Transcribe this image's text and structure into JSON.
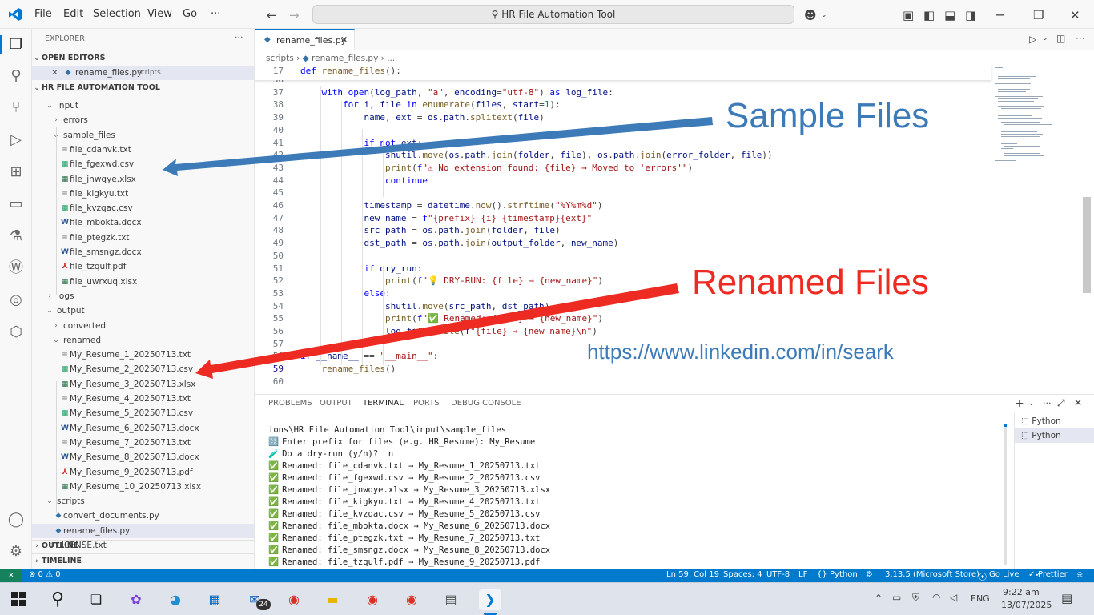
{
  "titlebar": {
    "menu": [
      "File",
      "Edit",
      "Selection",
      "View",
      "Go",
      "···"
    ],
    "search_text": "HR File Automation Tool"
  },
  "tab": {
    "label": "rename_files.py"
  },
  "breadcrumb": {
    "folder": "scripts",
    "file": "rename_files.py",
    "rest": "..."
  },
  "sticky": {
    "num": "17",
    "code": "def rename_files():"
  },
  "code_lines": [
    {
      "num": "36",
      "code": ""
    },
    {
      "num": "37",
      "code": "    with open(log_path, \"a\", encoding=\"utf-8\") as log_file:"
    },
    {
      "num": "38",
      "code": "        for i, file in enumerate(files, start=1):"
    },
    {
      "num": "39",
      "code": "            name, ext = os.path.splitext(file)"
    },
    {
      "num": "40",
      "code": ""
    },
    {
      "num": "41",
      "code": "            if not ext:"
    },
    {
      "num": "42",
      "code": "                shutil.move(os.path.join(folder, file), os.path.join(error_folder, file))"
    },
    {
      "num": "43",
      "code": "                print(f\"⚠ No extension found: {file} → Moved to 'errors'\")"
    },
    {
      "num": "44",
      "code": "                continue"
    },
    {
      "num": "45",
      "code": ""
    },
    {
      "num": "46",
      "code": "            timestamp = datetime.now().strftime(\"%Y%m%d\")"
    },
    {
      "num": "47",
      "code": "            new_name = f\"{prefix}_{i}_{timestamp}{ext}\""
    },
    {
      "num": "48",
      "code": "            src_path = os.path.join(folder, file)"
    },
    {
      "num": "49",
      "code": "            dst_path = os.path.join(output_folder, new_name)"
    },
    {
      "num": "50",
      "code": ""
    },
    {
      "num": "51",
      "code": "            if dry_run:"
    },
    {
      "num": "52",
      "code": "                print(f\"💡 DRY-RUN: {file} → {new_name}\")"
    },
    {
      "num": "53",
      "code": "            else:"
    },
    {
      "num": "54",
      "code": "                shutil.move(src_path, dst_path)"
    },
    {
      "num": "55",
      "code": "                print(f\"✅ Renamed: {file} → {new_name}\")"
    },
    {
      "num": "56",
      "code": "                log_file.write(f\"{file} → {new_name}\\n\")"
    },
    {
      "num": "57",
      "code": ""
    },
    {
      "num": "58",
      "code": "if __name__ == \"__main__\":"
    },
    {
      "num": "59",
      "code": "    rename_files()"
    },
    {
      "num": "60",
      "code": ""
    }
  ],
  "annotations": {
    "sample_files": "Sample Files",
    "renamed_files": "Renamed Files",
    "linkedin": "https://www.linkedin.com/in/seark"
  },
  "explorer": {
    "title": "EXPLORER",
    "open_editors_label": "OPEN EDITORS",
    "open_editor_file": "rename_files.py",
    "open_editor_folder": "scripts",
    "project_label": "HR FILE AUTOMATION TOOL",
    "outline_label": "OUTLINE",
    "timeline_label": "TIMELINE",
    "tree": [
      {
        "label": "input",
        "indent": 1,
        "chev": "⌄",
        "kind": "folder"
      },
      {
        "label": "errors",
        "indent": 2,
        "chev": "›",
        "kind": "folder"
      },
      {
        "label": "sample_files",
        "indent": 2,
        "chev": "⌄",
        "kind": "folder"
      },
      {
        "label": "file_cdanvk.txt",
        "indent": 3,
        "kind": "txt"
      },
      {
        "label": "file_fgexwd.csv",
        "indent": 3,
        "kind": "csv"
      },
      {
        "label": "file_jnwqye.xlsx",
        "indent": 3,
        "kind": "xlsx"
      },
      {
        "label": "file_kigkyu.txt",
        "indent": 3,
        "kind": "txt"
      },
      {
        "label": "file_kvzqac.csv",
        "indent": 3,
        "kind": "csv"
      },
      {
        "label": "file_mbokta.docx",
        "indent": 3,
        "kind": "docx"
      },
      {
        "label": "file_ptegzk.txt",
        "indent": 3,
        "kind": "txt"
      },
      {
        "label": "file_smsngz.docx",
        "indent": 3,
        "kind": "docx"
      },
      {
        "label": "file_tzqulf.pdf",
        "indent": 3,
        "kind": "pdf"
      },
      {
        "label": "file_uwrxuq.xlsx",
        "indent": 3,
        "kind": "xlsx"
      },
      {
        "label": "logs",
        "indent": 1,
        "chev": "›",
        "kind": "folder"
      },
      {
        "label": "output",
        "indent": 1,
        "chev": "⌄",
        "kind": "folder"
      },
      {
        "label": "converted",
        "indent": 2,
        "chev": "›",
        "kind": "folder"
      },
      {
        "label": "renamed",
        "indent": 2,
        "chev": "⌄",
        "kind": "folder"
      },
      {
        "label": "My_Resume_1_20250713.txt",
        "indent": 3,
        "kind": "txt"
      },
      {
        "label": "My_Resume_2_20250713.csv",
        "indent": 3,
        "kind": "csv"
      },
      {
        "label": "My_Resume_3_20250713.xlsx",
        "indent": 3,
        "kind": "xlsx"
      },
      {
        "label": "My_Resume_4_20250713.txt",
        "indent": 3,
        "kind": "txt"
      },
      {
        "label": "My_Resume_5_20250713.csv",
        "indent": 3,
        "kind": "csv"
      },
      {
        "label": "My_Resume_6_20250713.docx",
        "indent": 3,
        "kind": "docx"
      },
      {
        "label": "My_Resume_7_20250713.txt",
        "indent": 3,
        "kind": "txt"
      },
      {
        "label": "My_Resume_8_20250713.docx",
        "indent": 3,
        "kind": "docx"
      },
      {
        "label": "My_Resume_9_20250713.pdf",
        "indent": 3,
        "kind": "pdf"
      },
      {
        "label": "My_Resume_10_20250713.xlsx",
        "indent": 3,
        "kind": "xlsx"
      },
      {
        "label": "scripts",
        "indent": 1,
        "chev": "⌄",
        "kind": "folder"
      },
      {
        "label": "convert_documents.py",
        "indent": 2,
        "kind": "py"
      },
      {
        "label": "rename_files.py",
        "indent": 2,
        "kind": "py",
        "selected": true
      },
      {
        "label": "LICENSE.txt",
        "indent": 1,
        "kind": "txt"
      }
    ]
  },
  "panel": {
    "tabs": [
      "PROBLEMS",
      "OUTPUT",
      "TERMINAL",
      "PORTS",
      "DEBUG CONSOLE"
    ],
    "active_tab": "TERMINAL",
    "terminals": [
      "Python",
      "Python"
    ],
    "lines": [
      {
        "icon": "",
        "text": "ions\\HR File Automation Tool\\input\\sample_files"
      },
      {
        "icon": "🔠",
        "text": "Enter prefix for files (e.g. HR_Resume): My_Resume"
      },
      {
        "icon": "🧪",
        "text": "Do a dry-run (y/n)?  n"
      },
      {
        "icon": "✅",
        "text": "Renamed: file_cdanvk.txt → My_Resume_1_20250713.txt"
      },
      {
        "icon": "✅",
        "text": "Renamed: file_fgexwd.csv → My_Resume_2_20250713.csv"
      },
      {
        "icon": "✅",
        "text": "Renamed: file_jnwqye.xlsx → My_Resume_3_20250713.xlsx"
      },
      {
        "icon": "✅",
        "text": "Renamed: file_kigkyu.txt → My_Resume_4_20250713.txt"
      },
      {
        "icon": "✅",
        "text": "Renamed: file_kvzqac.csv → My_Resume_5_20250713.csv"
      },
      {
        "icon": "✅",
        "text": "Renamed: file_mbokta.docx → My_Resume_6_20250713.docx"
      },
      {
        "icon": "✅",
        "text": "Renamed: file_ptegzk.txt → My_Resume_7_20250713.txt"
      },
      {
        "icon": "✅",
        "text": "Renamed: file_smsngz.docx → My_Resume_8_20250713.docx"
      },
      {
        "icon": "✅",
        "text": "Renamed: file_tzqulf.pdf → My_Resume_9_20250713.pdf"
      }
    ]
  },
  "statusbar": {
    "problems": "⊗ 0 ⚠ 0",
    "position": "Ln 59, Col 19",
    "spaces": "Spaces: 4",
    "encoding": "UTF-8",
    "eol": "LF",
    "language": "Python",
    "interpreter": "3.13.5 (Microsoft Store)",
    "golive": "Go Live",
    "prettier": "Prettier"
  },
  "taskbar": {
    "time": "9:22 am",
    "date": "13/07/2025",
    "lang": "ENG",
    "mail_badge": "24"
  },
  "colors": {
    "accent": "#007acc",
    "sample_arrow": "#3d7ab8",
    "renamed_arrow": "#ee2b22",
    "keyword": "#0000ff",
    "string": "#a31515",
    "function": "#795e26"
  }
}
